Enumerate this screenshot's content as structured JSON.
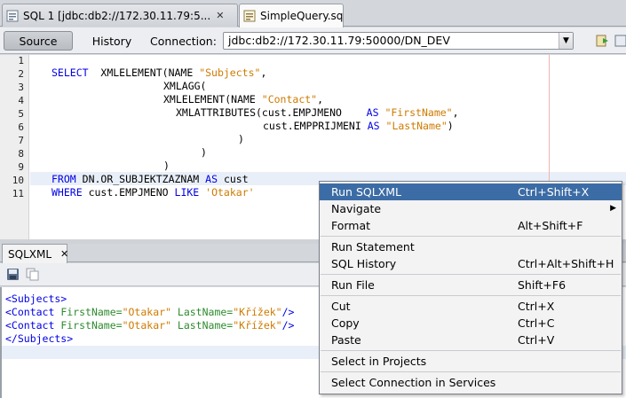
{
  "tabs": [
    {
      "label": "SQL 1  [jdbc:db2://172.30.11.79:5...",
      "close": "✕"
    },
    {
      "label": "SimpleQuery.sql",
      "close": "✕"
    }
  ],
  "toolbar": {
    "source_label": "Source",
    "history_label": "History",
    "connection_label": "Connection:",
    "connection_value": "jdbc:db2://172.30.11.79:50000/DN_DEV",
    "dropdown_arrow": "▼"
  },
  "editor": {
    "line_numbers": [
      "1",
      "2",
      "3",
      "4",
      "5",
      "6",
      "7",
      "8",
      "9",
      "10",
      "11"
    ],
    "code": {
      "l2_kw": "SELECT",
      "l2_fn": "XMLELEMENT(NAME ",
      "l2_str": "\"Subjects\"",
      "l2_tail": ",",
      "l3": "XMLAGG(",
      "l4_fn": "XMLELEMENT(NAME ",
      "l4_str": "\"Contact\"",
      "l4_tail": ",",
      "l5_fn": "XMLATTRIBUTES(cust.EMPJMENO",
      "l5_kw": "AS",
      "l5_str": "\"FirstName\"",
      "l5_tail": ",",
      "l6_fn": "cust.EMPPRIJMENI",
      "l6_kw": "AS",
      "l6_str": "\"LastName\"",
      "l6_tail": ")",
      "l7": ")",
      "l8": ")",
      "l9": ")",
      "l10_kw1": "FROM",
      "l10_obj": "DN.OR_SUBJEKTZAZNAM",
      "l10_kw2": "AS",
      "l10_alias": "cust",
      "l11_kw1": "WHERE",
      "l11_col": "cust.EMPJMENO",
      "l11_kw2": "LIKE",
      "l11_str": "'Otakar'"
    }
  },
  "output_panel": {
    "tab_label": "SQLXML",
    "tab_close": "✕",
    "lines": {
      "o1": "<Subjects>",
      "o2_tag": "<Contact",
      "o2_a1": "FirstName=",
      "o2_v1": "\"Otakar\"",
      "o2_a2": "LastName=",
      "o2_v2": "\"Křížek\"",
      "o2_end": "/>",
      "o3_tag": "<Contact",
      "o3_a1": "FirstName=",
      "o3_v1": "\"Otakar\"",
      "o3_a2": "LastName=",
      "o3_v2": "\"Křížek\"",
      "o3_end": "/>",
      "o4": "</Subjects>"
    }
  },
  "context_menu": {
    "items": [
      {
        "label": "Run SQLXML",
        "shortcut": "Ctrl+Shift+X"
      },
      {
        "label": "Navigate",
        "shortcut": "",
        "submenu": "▶"
      },
      {
        "label": "Format",
        "shortcut": "Alt+Shift+F"
      },
      {
        "label": "Run Statement",
        "shortcut": ""
      },
      {
        "label": "SQL History",
        "shortcut": "Ctrl+Alt+Shift+H"
      },
      {
        "label": "Run File",
        "shortcut": "Shift+F6"
      },
      {
        "label": "Cut",
        "shortcut": "Ctrl+X"
      },
      {
        "label": "Copy",
        "shortcut": "Ctrl+C"
      },
      {
        "label": "Paste",
        "shortcut": "Ctrl+V"
      },
      {
        "label": "Select in Projects",
        "shortcut": ""
      },
      {
        "label": "Select Connection in Services",
        "shortcut": ""
      }
    ]
  },
  "colors": {
    "keyword": "#0000e6",
    "string": "#ce7b00",
    "xml_attribute": "#2e8b2e",
    "menu_selection": "#3c6ca5"
  }
}
